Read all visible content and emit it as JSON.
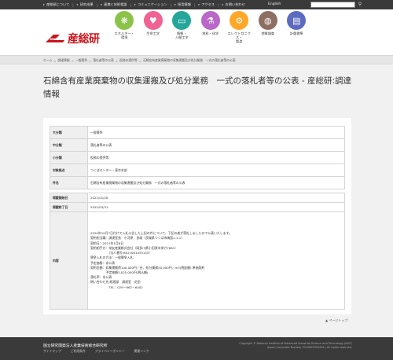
{
  "topnav": {
    "items": [
      "産総研について",
      "研究成果",
      "連携と技術相談",
      "コミュニケーション",
      "採用情報",
      "アクセス",
      "お問い合わせ"
    ],
    "lang": "English"
  },
  "logo": {
    "text": "産総研"
  },
  "categories": [
    {
      "label": "エネルギー・\n環境",
      "icon": "leaf-icon",
      "glyph": "❋",
      "color": "#8bc34a"
    },
    {
      "label": "生命工学",
      "icon": "heart-icon",
      "glyph": "♥",
      "color": "#f06292"
    },
    {
      "label": "情報・\n人間工学",
      "icon": "monitor-icon",
      "glyph": "▭",
      "color": "#26a69a"
    },
    {
      "label": "材料・化学",
      "icon": "flask-icon",
      "glyph": "⚗",
      "color": "#ba68c8"
    },
    {
      "label": "エレクトロニクス・\n製造",
      "icon": "chip-icon",
      "glyph": "⚙",
      "color": "#ffa726"
    },
    {
      "label": "地質調査",
      "icon": "globe-icon",
      "glyph": "◍",
      "color": "#8d6e63"
    },
    {
      "label": "計量標準",
      "icon": "ruler-icon",
      "glyph": "▤",
      "color": "#5c6bc0"
    }
  ],
  "breadcrumb": [
    "ホーム",
    "調達情報",
    "一般競争",
    "落札者等の公表",
    "役務の提供等",
    "石綿含有産業廃棄物の収集運搬及び処分業務　一式の落札者等の公表"
  ],
  "page_title": "石綿含有産業廃棄物の収集運搬及び処分業務　一式の落札者等の公表 - 産総研:調達情報",
  "table1": [
    {
      "h": "大分類",
      "v": "一般競争"
    },
    {
      "h": "中分類",
      "v": "落札者等の公表"
    },
    {
      "h": "小分類",
      "v": "役務の提供等"
    },
    {
      "h": "対象拠点",
      "v": "つくばセンター・東京本部"
    },
    {
      "h": "件名",
      "v": "石綿含有産業廃棄物の収集運搬及び処分業務　一式の落札者等の公表"
    }
  ],
  "table2": {
    "published_label": "掲載開始日",
    "published": "2021/01/28",
    "end_label": "掲載終了日",
    "end": "2022/03/31",
    "content_label": "内容",
    "lines": [
      "2020年10月7日付けで入札公告した上記の件について、下記の者が落札しましたので公表いたします。",
      "",
      "契約担当職：調達室長　小河原　良雄（茨城県つくば市梅園1-1-1）",
      "契約日：2021年1月6日",
      "契約相手方：栄友産業株式会社（岡多川県小田原市栄ガ7881）",
      "　　　　　　（法人番号:8021001033145）",
      "競争入札の方法：一般競争入札",
      "予定価格：非公表",
      "契約金額：収集運搬費100,000円／台、処分業務50,000円／m3(税抜額) 単価契約",
      "　　　　　予定総額3,025,000円(税込額)",
      "落札率：非公表",
      "",
      "問い合わせ先:経理部　調達室　花田",
      "　　　　　　TEL：029－862－6402"
    ]
  },
  "pagetop": "ページトップ",
  "footer": {
    "org": "国立研究開発法人産業技術総合研究所",
    "links": [
      "サイトマップ",
      "ご利用条件",
      "プライバシーポリシー",
      "関連リンク"
    ],
    "copyright1": "Copyright © National Institute of Advanced Industrial Science and Technology (AIST)",
    "copyright2": "(Japan Corporate Number 7010005005425). All rights reserved."
  }
}
